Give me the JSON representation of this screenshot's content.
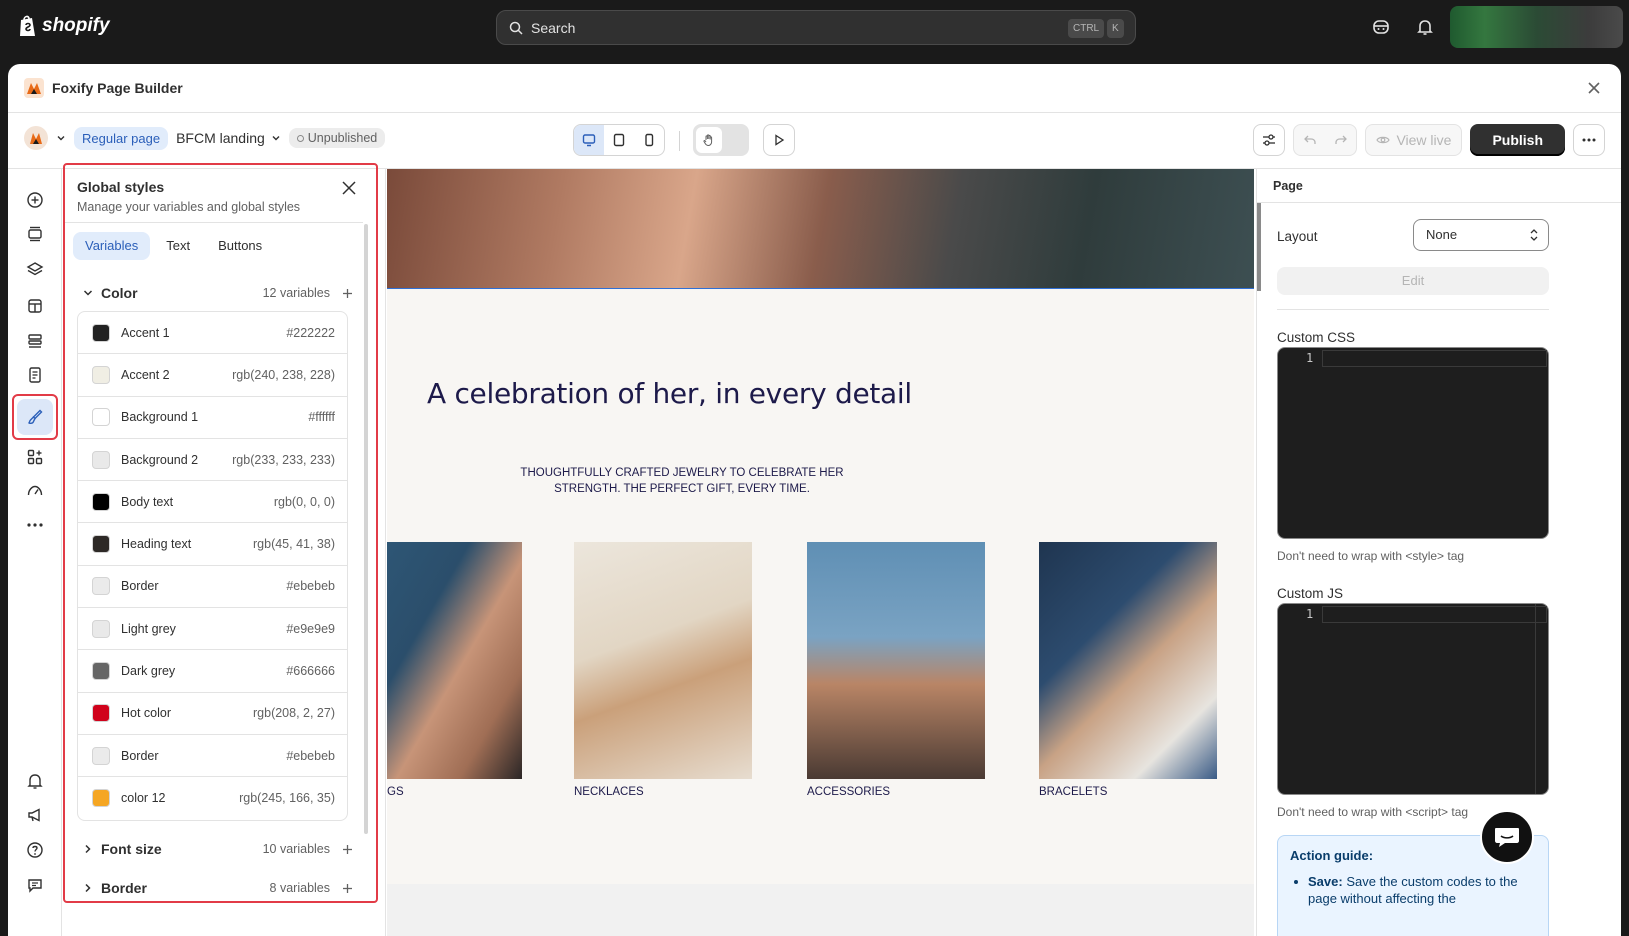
{
  "topbar": {
    "logo_text": "shopify",
    "search_placeholder": "Search",
    "kbd_ctrl": "CTRL",
    "kbd_k": "K"
  },
  "window": {
    "app_title": "Foxify Page Builder"
  },
  "toolbar": {
    "page_type": "Regular page",
    "page_name": "BFCM landing",
    "status": "Unpublished",
    "view_live": "View live",
    "publish": "Publish"
  },
  "global_styles": {
    "title": "Global styles",
    "subtitle": "Manage your variables and global styles",
    "tabs": [
      "Variables",
      "Text",
      "Buttons"
    ],
    "active_tab": "Variables",
    "groups": [
      {
        "name": "Color",
        "count": "12 variables",
        "expanded": true
      },
      {
        "name": "Font size",
        "count": "10 variables",
        "expanded": false
      },
      {
        "name": "Border",
        "count": "8 variables",
        "expanded": false
      }
    ],
    "colors": [
      {
        "name": "Accent 1",
        "value": "#222222",
        "swatch": "#222222"
      },
      {
        "name": "Accent 2",
        "value": "rgb(240, 238, 228)",
        "swatch": "#f0eee4"
      },
      {
        "name": "Background 1",
        "value": "#ffffff",
        "swatch": "#ffffff"
      },
      {
        "name": "Background 2",
        "value": "rgb(233, 233, 233)",
        "swatch": "#e9e9e9"
      },
      {
        "name": "Body text",
        "value": "rgb(0, 0, 0)",
        "swatch": "#000000"
      },
      {
        "name": "Heading text",
        "value": "rgb(45, 41, 38)",
        "swatch": "#2d2926"
      },
      {
        "name": "Border",
        "value": "#ebebeb",
        "swatch": "#ebebeb"
      },
      {
        "name": "Light grey",
        "value": "#e9e9e9",
        "swatch": "#e9e9e9"
      },
      {
        "name": "Dark grey",
        "value": "#666666",
        "swatch": "#666666"
      },
      {
        "name": "Hot color",
        "value": "rgb(208, 2, 27)",
        "swatch": "#d0021b"
      },
      {
        "name": "Border",
        "value": "#ebebeb",
        "swatch": "#ebebeb"
      },
      {
        "name": "color 12",
        "value": "rgb(245, 166, 35)",
        "swatch": "#f5a623"
      }
    ]
  },
  "canvas": {
    "headline": "A celebration of her, in every detail",
    "subcopy_line1": "THOUGHTFULLY CRAFTED JEWELRY TO CELEBRATE HER",
    "subcopy_line2": "STRENGTH. THE PERFECT GIFT, EVERY TIME.",
    "captions": [
      "GS",
      "NECKLACES",
      "ACCESSORIES",
      "BRACELETS"
    ]
  },
  "right_panel": {
    "section": "Page",
    "layout_label": "Layout",
    "layout_value": "None",
    "edit_label": "Edit",
    "css_label": "Custom CSS",
    "css_hint": "Don't need to wrap with <style> tag",
    "js_label": "Custom JS",
    "js_hint": "Don't need to wrap with <script> tag",
    "line_number": "1",
    "guide_title": "Action guide:",
    "guide_save_bold": "Save:",
    "guide_save_text": "Save the custom codes to the page without affecting the"
  },
  "colors": {
    "accent_blue": "#2b5fb9",
    "highlight_red": "#e23b47",
    "headline_navy": "#1d1a4a"
  }
}
